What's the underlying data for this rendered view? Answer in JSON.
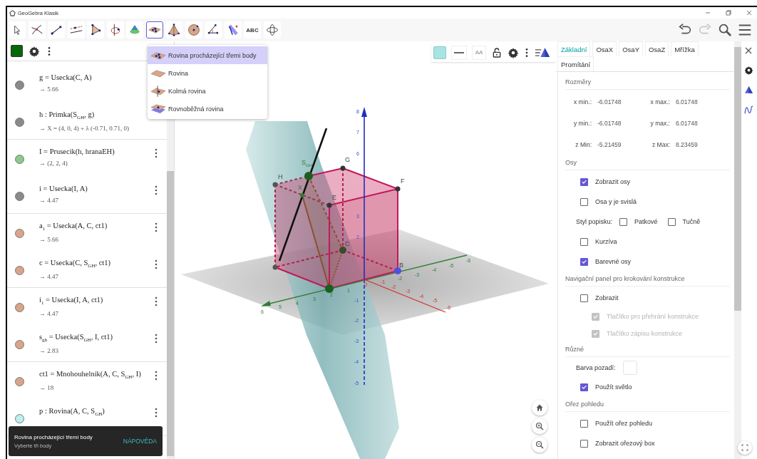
{
  "window": {
    "title": "GeoGebra Klasik"
  },
  "toolbar": {
    "tools": [
      {
        "kind": "move",
        "selected": false
      },
      {
        "kind": "intersect",
        "selected": false
      },
      {
        "kind": "segment",
        "selected": false
      },
      {
        "kind": "parallel",
        "selected": false
      },
      {
        "kind": "polygon",
        "selected": false
      },
      {
        "kind": "rotate",
        "selected": false
      },
      {
        "kind": "cone",
        "selected": false
      },
      {
        "kind": "plane3",
        "selected": true
      },
      {
        "kind": "pyramid",
        "selected": false
      },
      {
        "kind": "sphere",
        "selected": false
      },
      {
        "kind": "angle",
        "selected": false
      },
      {
        "kind": "reflect",
        "selected": false
      },
      {
        "kind": "text",
        "label": "ABC",
        "selected": false
      },
      {
        "kind": "rotateview",
        "selected": false
      }
    ],
    "redo_disabled": true
  },
  "tool_menu": {
    "items": [
      {
        "kind": "plane3",
        "label": "Rovina procházející třemi body",
        "selected": true
      },
      {
        "kind": "plane",
        "label": "Rovina",
        "selected": false
      },
      {
        "kind": "perpendicular",
        "label": "Kolmá rovina",
        "selected": false
      },
      {
        "kind": "parallel",
        "label": "Rovnoběžná rovina",
        "selected": false
      }
    ]
  },
  "algebra": {
    "groups": [
      {
        "items": [
          {
            "formula": "g = Usecka(C, A)",
            "value": "→ 5.66",
            "color": "#8a8a8a",
            "menu": false
          },
          {
            "formula": "h : Primka(S$_{GH}$, g)",
            "value": "→ X = (4, 0, 4) + λ (-0.71, 0.71, 0)",
            "color": "#8a8a8a",
            "menu": false
          }
        ]
      },
      {
        "items": [
          {
            "formula": "I = Prusecik(h, hranaEH)",
            "value": "→ (2, 2, 4)",
            "color": "#8cc98c",
            "menu": true
          },
          {
            "formula": "i = Usecka(I, A)",
            "value": "→ 4.47",
            "color": "#8a8a8a",
            "menu": true
          }
        ]
      },
      {
        "items": [
          {
            "formula": "a$_{1}$ = Usecka(A, C, ct1)",
            "value": "→ 5.66",
            "color": "#d9a58a",
            "menu": true
          },
          {
            "formula": "c = Usecka(C, S$_{GH}$, ct1)",
            "value": "→ 4.47",
            "color": "#d9a58a",
            "menu": true
          }
        ]
      },
      {
        "items": [
          {
            "formula": "i$_{1}$ = Usecka(I, A, ct1)",
            "value": "→ 4.47",
            "color": "#d9a58a",
            "menu": true
          },
          {
            "formula": "s$_{gh}$ = Usecka(S$_{GH}$, I, ct1)",
            "value": "→ 2.83",
            "color": "#d9a58a",
            "menu": true
          }
        ]
      },
      {
        "items": [
          {
            "formula": "ct1 = Mnohouhelnik(A, C, S$_{GH}$, I)",
            "value": "→ 18",
            "color": "#d9a58a",
            "menu": true
          },
          {
            "formula": "p : Rovina(A, C, S$_{GH}$)",
            "color": "#bdeff0",
            "menu": true
          }
        ]
      }
    ]
  },
  "graphics": {
    "style_bar": {
      "text_size": "AA"
    },
    "point_labels": [
      "G",
      "F",
      "H",
      "E",
      "X",
      "C",
      "B",
      "S$_{GH}$"
    ],
    "z_ticks": [
      "8",
      "7",
      "6",
      "3",
      "2",
      "-1",
      "-2",
      "-3",
      "-4",
      "-5"
    ],
    "y_ticks": [
      "6",
      "5",
      "4",
      "3",
      "2",
      "1",
      "-2",
      "-3",
      "-4",
      "-5",
      "-6"
    ],
    "x_ticks": [
      "0",
      "-1",
      "-2",
      "-3",
      "-4",
      "-5",
      "-6"
    ]
  },
  "settings": {
    "tabs": [
      {
        "label": "Základní",
        "selected": true
      },
      {
        "label": "OsaX",
        "selected": false
      },
      {
        "label": "OsaY",
        "selected": false
      },
      {
        "label": "OsaZ",
        "selected": false
      },
      {
        "label": "Mřížka",
        "selected": false
      },
      {
        "label": "Promítání",
        "selected": false
      }
    ],
    "sections": [
      {
        "title": "Rozměry",
        "items": [
          {
            "kind": "range",
            "min_label": "x min.:",
            "min": "-6.01748",
            "max_label": "x max.:",
            "max": "6.01748"
          },
          {
            "kind": "range",
            "min_label": "y min.:",
            "min": "-6.01748",
            "max_label": "y max.:",
            "max": "6.01748"
          },
          {
            "kind": "range",
            "min_label": "z Min:",
            "min": "-5.21459",
            "max_label": "z Max:",
            "max": "8.23459"
          }
        ]
      },
      {
        "title": "Osy",
        "items": [
          {
            "kind": "checkbox",
            "label": "Zobrazit osy",
            "checked": true,
            "disabled": false
          },
          {
            "kind": "checkbox",
            "label": "Osa y je svislá",
            "checked": false,
            "disabled": false
          },
          {
            "kind": "style",
            "label": "Styl popisku:",
            "options": [
              {
                "label": "Patkové",
                "checked": false
              },
              {
                "label": "Tučně",
                "checked": false
              }
            ]
          },
          {
            "kind": "checkbox",
            "label": "Kurzíva",
            "checked": false,
            "disabled": false
          },
          {
            "kind": "checkbox",
            "label": "Barevné osy",
            "checked": true,
            "disabled": false
          }
        ]
      },
      {
        "title": "Navigační panel pro krokování konstrukce",
        "items": [
          {
            "kind": "checkbox",
            "label": "Zobrazit",
            "checked": false,
            "disabled": false
          },
          {
            "kind": "checkbox",
            "label": "Tlačítko pro přehrání konstrukce",
            "checked": true,
            "disabled": true
          },
          {
            "kind": "checkbox",
            "label": "Tlačítko zápisu konstrukce",
            "checked": true,
            "disabled": true
          }
        ]
      },
      {
        "title": "Různé",
        "items": [
          {
            "kind": "color",
            "label": "Barva pozadí:"
          },
          {
            "kind": "checkbox",
            "label": "Použít světlo",
            "checked": true,
            "disabled": false
          }
        ]
      },
      {
        "title": "Ořez pohledu",
        "items": [
          {
            "kind": "checkbox",
            "label": "Použít ořez pohledu",
            "checked": false,
            "disabled": false
          },
          {
            "kind": "checkbox",
            "label": "Zobrazit ořezový box",
            "checked": false,
            "disabled": false
          }
        ]
      }
    ]
  },
  "toast": {
    "title": "Rovina procházející třemi body",
    "subtitle": "Vyberte tři body",
    "action": "NÁPOVĚDA"
  }
}
